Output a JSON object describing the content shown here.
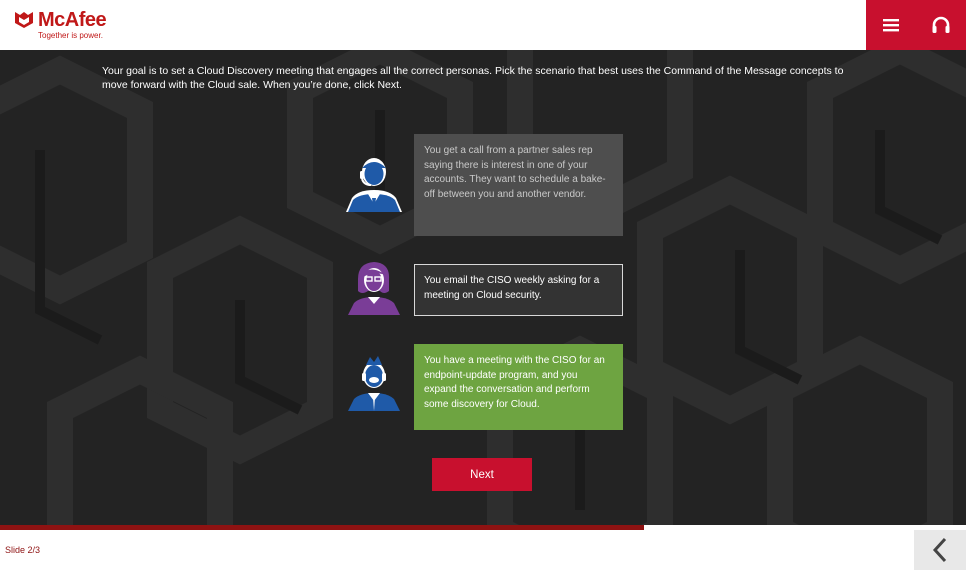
{
  "header": {
    "logo_text": "McAfee",
    "logo_tagline": "Together is power.",
    "menu_icon": "hamburger-menu-icon",
    "support_icon": "headphones-icon"
  },
  "main": {
    "instructions": "Your goal is to set a Cloud Discovery meeting that engages all the correct personas. Pick the scenario that best uses the Command of the Message concepts to move forward with the Cloud sale. When you’re done, click Next.",
    "options": [
      {
        "text": "You get a call from a partner sales rep saying there is interest in one of your accounts. They want to schedule a bake-off between you and another vendor.",
        "persona_icon": "headset-agent-icon",
        "state": "disabled"
      },
      {
        "text": "You email the CISO weekly asking for a meeting on Cloud security.",
        "persona_icon": "woman-glasses-icon",
        "state": "default"
      },
      {
        "text": "You have a meeting with the CISO for an endpoint-update program, and you expand the conversation and perform some discovery for Cloud.",
        "persona_icon": "man-headset-icon",
        "state": "selected"
      }
    ],
    "next_label": "Next"
  },
  "progress": {
    "fraction": 0.667
  },
  "footer": {
    "slide_counter": "Slide 2/3",
    "back_icon": "chevron-left-icon"
  },
  "colors": {
    "brand_red": "#c8102e",
    "dark_red": "#8e1212",
    "option_disabled": "#4e4e4e",
    "option_selected": "#6ea441",
    "stage_bg": "#232323"
  }
}
